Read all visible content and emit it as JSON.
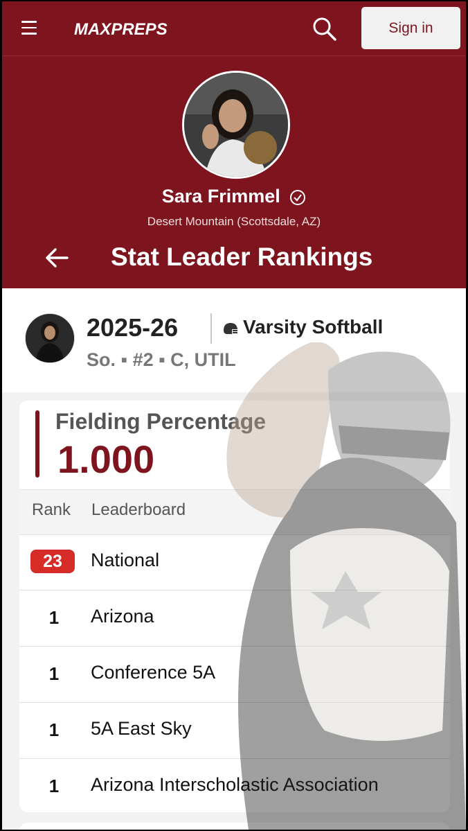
{
  "topbar": {
    "logo_text": "MAXPREPS",
    "signin_label": "Sign in"
  },
  "player": {
    "name": "Sara Frimmel",
    "school": "Desert Mountain (Scottsdale, AZ)"
  },
  "page": {
    "title": "Stat Leader Rankings"
  },
  "season": {
    "year": "2025-26",
    "sport": "Varsity Softball",
    "meta": "So. ▪ #2 ▪ C, UTIL"
  },
  "stat": {
    "label": "Fielding Percentage",
    "value": "1.000"
  },
  "table": {
    "headers": {
      "rank": "Rank",
      "board": "Leaderboard"
    },
    "rows": [
      {
        "rank": "23",
        "board": "National"
      },
      {
        "rank": "1",
        "board": "Arizona"
      },
      {
        "rank": "1",
        "board": "Conference 5A"
      },
      {
        "rank": "1",
        "board": "5A East Sky"
      },
      {
        "rank": "1",
        "board": "Arizona Interscholastic Association"
      }
    ]
  },
  "colors": {
    "brand": "#7e141e",
    "badge": "#d62b27"
  },
  "icons": [
    "hamburger-icon",
    "search-icon",
    "verified-icon",
    "back-arrow-icon",
    "softball-helmet-icon"
  ]
}
